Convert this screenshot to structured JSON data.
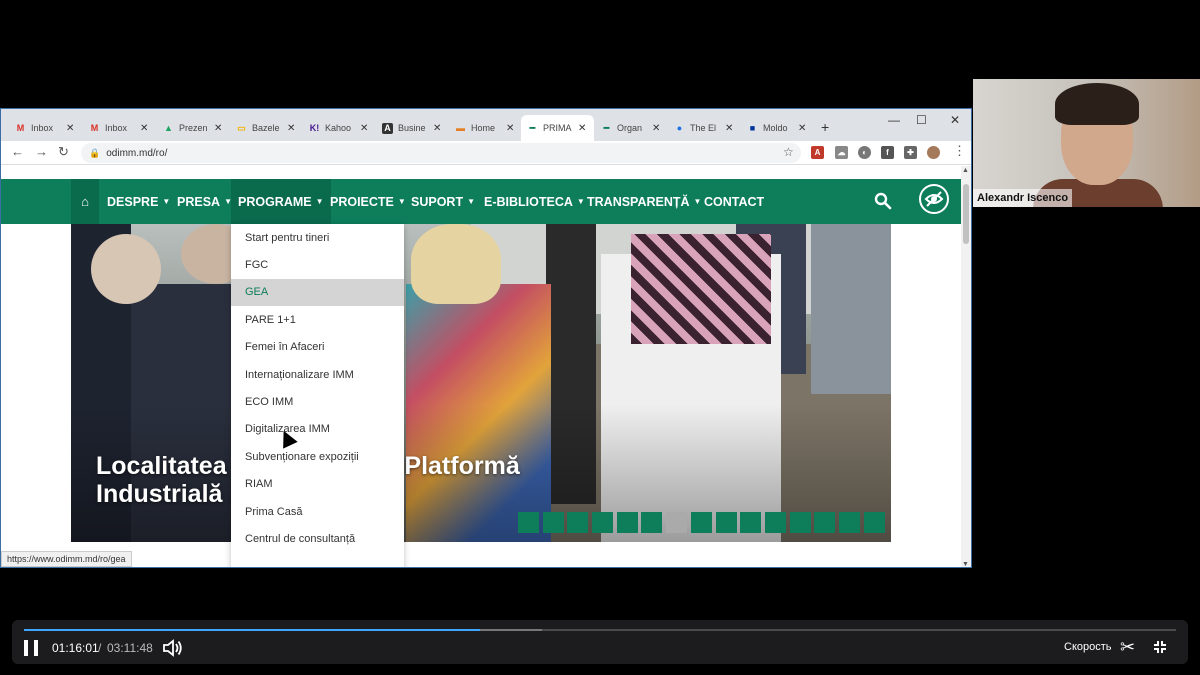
{
  "browser": {
    "tabs": [
      {
        "label": "Inbox",
        "icon": "gmail-icon",
        "icon_char": "M",
        "icon_color": "#d93025",
        "icon_bg": "transparent"
      },
      {
        "label": "Inbox",
        "icon": "gmail-icon",
        "icon_char": "M",
        "icon_color": "#d93025",
        "icon_bg": "transparent"
      },
      {
        "label": "Prezen",
        "icon": "google-drive-icon",
        "icon_char": "▲",
        "icon_color": "#1fa463",
        "icon_bg": "transparent"
      },
      {
        "label": "Bazele",
        "icon": "google-slides-icon",
        "icon_char": "▭",
        "icon_color": "#f4b400",
        "icon_bg": "transparent"
      },
      {
        "label": "Kahoo",
        "icon": "kahoot-icon",
        "icon_char": "K!",
        "icon_color": "#46178f",
        "icon_bg": "transparent"
      },
      {
        "label": "Busine",
        "icon": "letter-a-icon",
        "icon_char": "A",
        "icon_color": "#ffffff",
        "icon_bg": "#333333"
      },
      {
        "label": "Home",
        "icon": "rainbow-flag-icon",
        "icon_char": "▬",
        "icon_color": "#e67e22",
        "icon_bg": "transparent"
      },
      {
        "label": "PRIMA",
        "icon": "odimm-icon",
        "icon_char": "━",
        "icon_color": "#0d7d5a",
        "icon_bg": "transparent",
        "active": true
      },
      {
        "label": "Organ",
        "icon": "odimm-icon",
        "icon_char": "━",
        "icon_color": "#0d7d5a",
        "icon_bg": "transparent"
      },
      {
        "label": "The El",
        "icon": "globe-icon",
        "icon_char": "●",
        "icon_color": "#1a73e8",
        "icon_bg": "transparent"
      },
      {
        "label": "Moldo",
        "icon": "eu-flag-icon",
        "icon_char": "■",
        "icon_color": "#003399",
        "icon_bg": "transparent"
      }
    ],
    "url": "odimm.md/ro/",
    "status_url": "https://www.odimm.md/ro/gea"
  },
  "site": {
    "nav": [
      {
        "label": "DESPRE",
        "has_menu": true
      },
      {
        "label": "PRESA",
        "has_menu": true
      },
      {
        "label": "PROGRAME",
        "has_menu": true,
        "open": true
      },
      {
        "label": "PROIECTE",
        "has_menu": true
      },
      {
        "label": "SUPORT",
        "has_menu": true
      },
      {
        "label": "E-BIBLIOTECA",
        "has_menu": true
      },
      {
        "label": "TRANSPARENȚĂ",
        "has_menu": true
      },
      {
        "label": "CONTACT",
        "has_menu": false
      }
    ],
    "dropdown": [
      "Start pentru tineri",
      "FGC",
      "GEA",
      "PARE 1+1",
      "Femei în Afaceri",
      "Internaționalizare IMM",
      "ECO IMM",
      "Digitalizarea IMM",
      "Subvenționare expoziții",
      "RIAM",
      "Prima Casă",
      "Centrul de consultanță"
    ],
    "dropdown_hover_index": 2,
    "headline_line1": "Localitatea ... va găzdui o Platformă",
    "headline_line2": "Industrială ... onală",
    "slider_count": 15,
    "slider_active_index": 6,
    "brand_color": "#0d7d5a"
  },
  "webcam": {
    "name": "Alexandr Iscenco"
  },
  "player": {
    "time_current": "01:16:01",
    "separator": "/",
    "time_total": "03:11:48",
    "speed_label": "Скорость",
    "progress_fraction": 0.396,
    "buffered_fraction": 0.45
  }
}
